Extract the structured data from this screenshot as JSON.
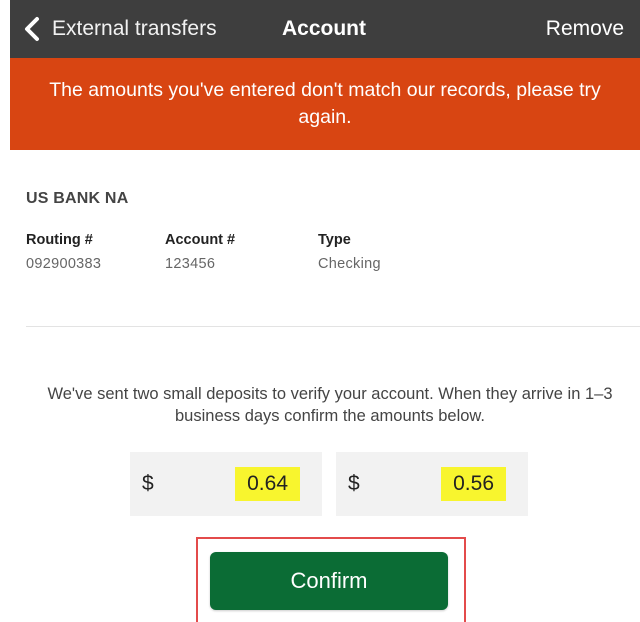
{
  "nav": {
    "back_label": "External transfers",
    "title": "Account",
    "remove_label": "Remove",
    "back_icon": "chevron-left-icon"
  },
  "error": {
    "message": "The amounts you've entered don't match our records, please try again."
  },
  "account": {
    "bank_name": "US BANK NA",
    "routing_label": "Routing #",
    "routing_value": "092900383",
    "account_label": "Account #",
    "account_value": "123456",
    "type_label": "Type",
    "type_value": "Checking"
  },
  "verify": {
    "instructions": "We've sent two small deposits to verify your account. When they arrive in 1–3 business days confirm the amounts below.",
    "currency_symbol": "$",
    "amount_1": "0.64",
    "amount_2": "0.56"
  },
  "confirm_label": "Confirm",
  "colors": {
    "nav_bg": "#3e3e3e",
    "error_bg": "#d84512",
    "confirm_bg": "#0b6c35",
    "highlight": "#f8f52e",
    "annotation_frame": "#e34b4b"
  }
}
